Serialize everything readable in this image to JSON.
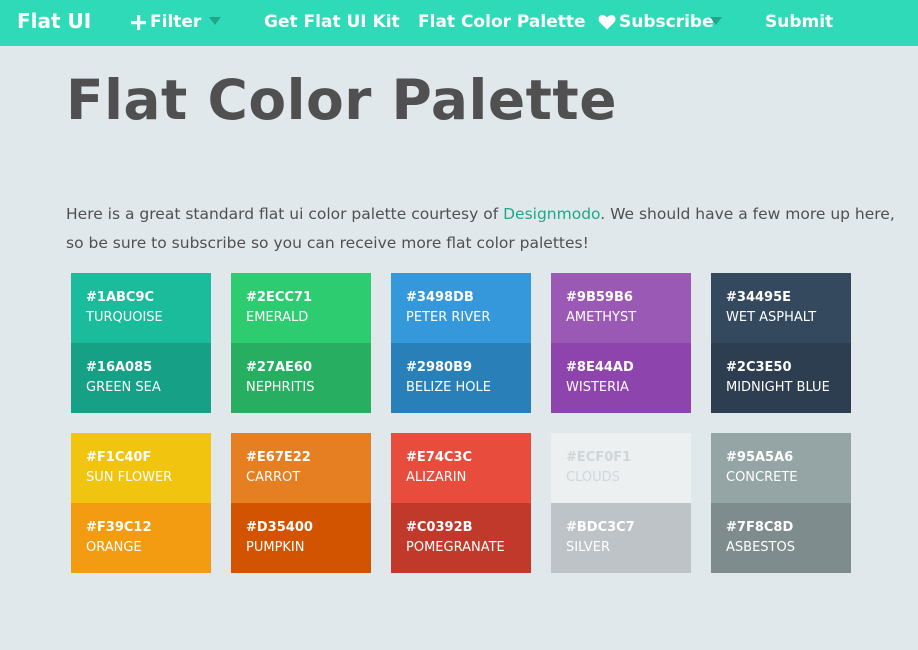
{
  "navbar": {
    "brand": "Flat UI",
    "items": [
      {
        "label": "Filter",
        "icon": "plus-icon"
      },
      {
        "label": "Get Flat UI Kit"
      },
      {
        "label": "Flat Color Palette"
      },
      {
        "label": "Subscribe",
        "icon": "heart-icon"
      },
      {
        "label": "Submit"
      }
    ]
  },
  "page": {
    "title": "Flat Color Palette",
    "intro_before": "Here is a great standard flat ui color palette courtesy of ",
    "intro_link": "Designmodo",
    "intro_after": ". We should have a few more up here, so be sure to subscribe so you can receive more flat color palettes!"
  },
  "swatches": [
    {
      "top": {
        "hex": "#1ABC9C",
        "name": "TURQUOISE",
        "color": "#1abc9c"
      },
      "bottom": {
        "hex": "#16A085",
        "name": "GREEN SEA",
        "color": "#16a085"
      }
    },
    {
      "top": {
        "hex": "#2ECC71",
        "name": "EMERALD",
        "color": "#2ecc71"
      },
      "bottom": {
        "hex": "#27AE60",
        "name": "NEPHRITIS",
        "color": "#27ae60"
      }
    },
    {
      "top": {
        "hex": "#3498DB",
        "name": "PETER RIVER",
        "color": "#3498db"
      },
      "bottom": {
        "hex": "#2980B9",
        "name": "BELIZE HOLE",
        "color": "#2980b9"
      }
    },
    {
      "top": {
        "hex": "#9B59B6",
        "name": "AMETHYST",
        "color": "#9b59b6"
      },
      "bottom": {
        "hex": "#8E44AD",
        "name": "WISTERIA",
        "color": "#8e44ad"
      }
    },
    {
      "top": {
        "hex": "#34495E",
        "name": "WET ASPHALT",
        "color": "#34495e"
      },
      "bottom": {
        "hex": "#2C3E50",
        "name": "MIDNIGHT BLUE",
        "color": "#2c3e50"
      }
    },
    {
      "top": {
        "hex": "#F1C40F",
        "name": "SUN FLOWER",
        "color": "#f1c40f"
      },
      "bottom": {
        "hex": "#F39C12",
        "name": "ORANGE",
        "color": "#f39c12"
      }
    },
    {
      "top": {
        "hex": "#E67E22",
        "name": "CARROT",
        "color": "#e67e22"
      },
      "bottom": {
        "hex": "#D35400",
        "name": "PUMPKIN",
        "color": "#d35400"
      }
    },
    {
      "top": {
        "hex": "#E74C3C",
        "name": "ALIZARIN",
        "color": "#e74c3c"
      },
      "bottom": {
        "hex": "#C0392B",
        "name": "POMEGRANATE",
        "color": "#c0392b"
      }
    },
    {
      "top": {
        "hex": "#ECF0F1",
        "name": "CLOUDS",
        "color": "#ecf0f1"
      },
      "bottom": {
        "hex": "#BDC3C7",
        "name": "SILVER",
        "color": "#bdc3c7"
      }
    },
    {
      "top": {
        "hex": "#95A5A6",
        "name": "CONCRETE",
        "color": "#95a5a6"
      },
      "bottom": {
        "hex": "#7F8C8D",
        "name": "ASBESTOS",
        "color": "#7f8c8d"
      }
    }
  ]
}
